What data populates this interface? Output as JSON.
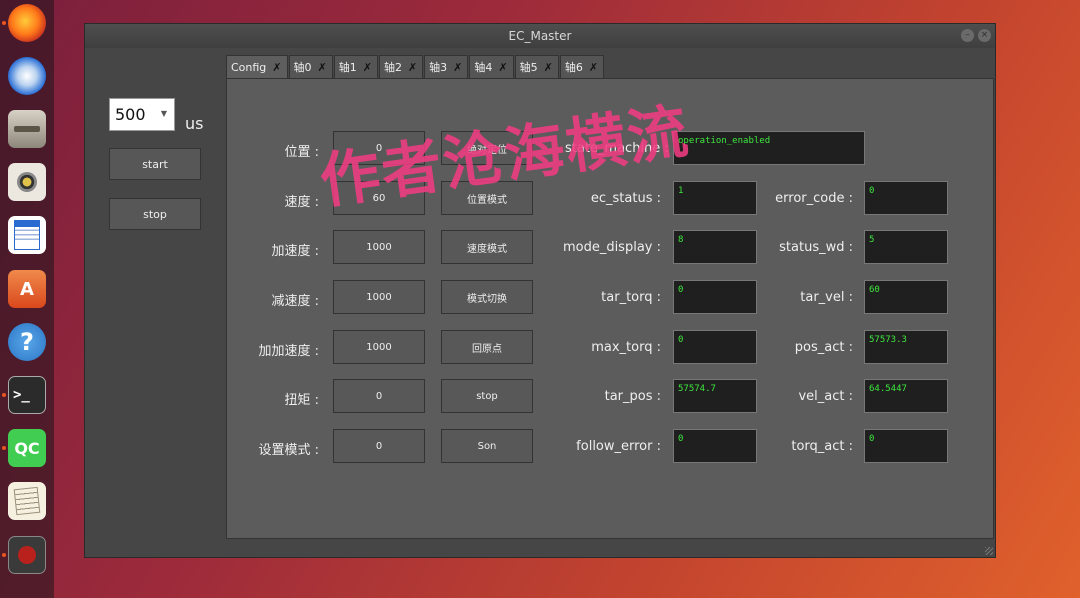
{
  "window": {
    "title": "EC_Master",
    "close": "×"
  },
  "period": {
    "value": "500",
    "unit": "us"
  },
  "side_buttons": {
    "start": "start",
    "stop": "stop"
  },
  "tabs": [
    {
      "label": "Config"
    },
    {
      "label": "轴0"
    },
    {
      "label": "轴1"
    },
    {
      "label": "轴2"
    },
    {
      "label": "轴3"
    },
    {
      "label": "轴4"
    },
    {
      "label": "轴5"
    },
    {
      "label": "轴6"
    }
  ],
  "motion": {
    "position_label": "位置 :",
    "position_value": "0",
    "speed_label": "速度 :",
    "speed_value": "60",
    "accel_label": "加速度 :",
    "accel_value": "1000",
    "decel_label": "减速度 :",
    "decel_value": "1000",
    "jerk_label": "加加速度 :",
    "jerk_value": "1000",
    "torque_label": "扭矩 :",
    "torque_value": "0",
    "mode_label": "设置模式 :",
    "mode_value": "0"
  },
  "actions": {
    "absolute_position": "绝对定位",
    "position_mode": "位置模式",
    "velocity_mode": "速度模式",
    "mode_switch": "模式切换",
    "home": "回原点",
    "stop": "stop",
    "son": "Son"
  },
  "status": {
    "state_machine_label": "state_machine :",
    "state_machine_value": "operation_enabled",
    "errorcode_label": "ec_status :",
    "errorcode_value": "1",
    "error_code_label": "error_code :",
    "error_code_value": "0",
    "mode_display_label": "mode_display :",
    "mode_display_value": "8",
    "status_wd_label": "status_wd :",
    "status_wd_value": "5",
    "tar_torq_label": "tar_torq :",
    "tar_torq_value": "0",
    "tar_vel_label": "tar_vel :",
    "tar_vel_value": "60",
    "max_torq_label": "max_torq :",
    "max_torq_value": "0",
    "pos_act_label": "pos_act :",
    "pos_act_value": "57573.3",
    "tar_pos_label": "tar_pos :",
    "tar_pos_value": "57574.7",
    "vel_act_label": "vel_act :",
    "vel_act_value": "64.5447",
    "follow_error_label": "follow_error :",
    "follow_error_value": "0",
    "torq_act_label": "torq_act :",
    "torq_act_value": "0"
  },
  "watermark": "作者沧海横流",
  "dock": [
    {
      "icon": "firefox-icon",
      "color": "#e66000"
    },
    {
      "icon": "thunderbird-icon",
      "color": "#2a6fd6"
    },
    {
      "icon": "files-icon",
      "color": "#b0a89a"
    },
    {
      "icon": "rhythmbox-icon",
      "color": "#e0c24a"
    },
    {
      "icon": "writer-icon",
      "color": "#2a6bd1"
    },
    {
      "icon": "software-icon",
      "color": "#e9622a"
    },
    {
      "icon": "help-icon",
      "color": "#3b8ed8"
    },
    {
      "icon": "terminal-icon",
      "color": "#2b2b2b"
    },
    {
      "icon": "qtcreator-icon",
      "color": "#41cd52"
    },
    {
      "icon": "text-editor-icon",
      "color": "#f5f0e0"
    },
    {
      "icon": "recorder-icon",
      "color": "#b8211c"
    }
  ],
  "accent_color": "#e95420"
}
